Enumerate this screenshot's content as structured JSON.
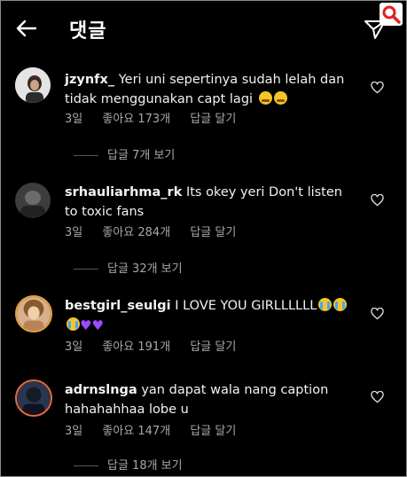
{
  "header": {
    "title": "댓글"
  },
  "comments": [
    {
      "username": "jzynfx_",
      "text": "Yeri uni sepertinya sudah lelah dan tidak menggunakan capt lagi",
      "time": "3일",
      "likes": "좋아요 173개",
      "reply": "답글 달기",
      "view_replies": "답글 7개 보기"
    },
    {
      "username": "srhauliarhma_rk",
      "text": "Its okey yeri Don't listen to toxic fans",
      "time": "3일",
      "likes": "좋아요 284개",
      "reply": "답글 달기",
      "view_replies": "답글 32개 보기"
    },
    {
      "username": "bestgirl_seulgi",
      "text": "I LOVE YOU GIRLLLLLL",
      "time": "3일",
      "likes": "좋아요 191개",
      "reply": "답글 달기",
      "view_replies": ""
    },
    {
      "username": "adrnslnga",
      "text": "yan dapat wala nang caption hahahahhaa lobe u",
      "time": "3일",
      "likes": "좋아요 147개",
      "reply": "답글 달기",
      "view_replies": "답글 18개 보기"
    }
  ],
  "colors": {
    "background": "#000000",
    "muted": "#a8a8a8",
    "search_badge": "#e02020"
  }
}
